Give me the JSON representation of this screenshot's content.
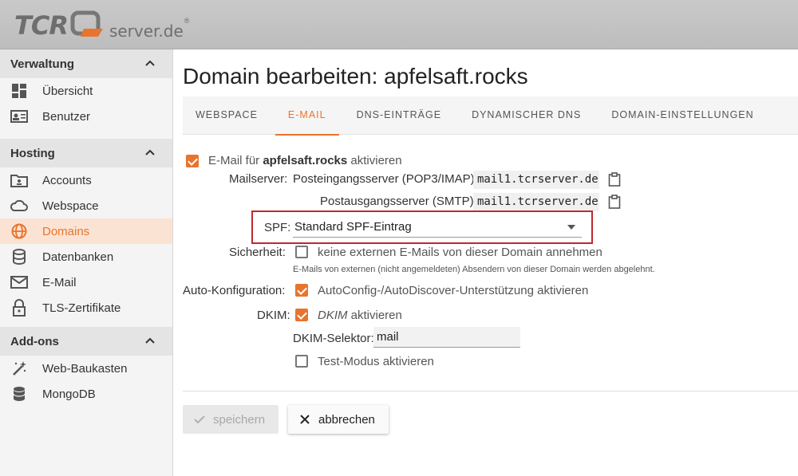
{
  "logo": {
    "brand": "TCR",
    "domain": "server.de",
    "reg": "®"
  },
  "sidebar": {
    "sections": [
      {
        "title": "Verwaltung",
        "items": [
          {
            "label": "Übersicht",
            "icon": "dashboard-icon"
          },
          {
            "label": "Benutzer",
            "icon": "id-card-icon"
          }
        ]
      },
      {
        "title": "Hosting",
        "items": [
          {
            "label": "Accounts",
            "icon": "account-folder-icon"
          },
          {
            "label": "Webspace",
            "icon": "cloud-icon"
          },
          {
            "label": "Domains",
            "icon": "globe-icon",
            "active": true
          },
          {
            "label": "Datenbanken",
            "icon": "database-icon"
          },
          {
            "label": "E-Mail",
            "icon": "envelope-icon"
          },
          {
            "label": "TLS-Zertifikate",
            "icon": "lock-icon"
          }
        ]
      },
      {
        "title": "Add-ons",
        "items": [
          {
            "label": "Web-Baukasten",
            "icon": "magic-wand-icon"
          },
          {
            "label": "MongoDB",
            "icon": "database-icon"
          }
        ]
      }
    ]
  },
  "page": {
    "title": "Domain bearbeiten: apfelsaft.rocks"
  },
  "tabs": [
    "WEBSPACE",
    "E-MAIL",
    "DNS-EINTRÄGE",
    "DYNAMISCHER DNS",
    "DOMAIN-EINSTELLUNGEN"
  ],
  "active_tab": "E-MAIL",
  "form": {
    "enable_prefix": "E-Mail für ",
    "enable_domain": "apfelsaft.rocks",
    "enable_suffix": " aktivieren",
    "enable_checked": true,
    "mailserver_label": "Mailserver:",
    "incoming_label": "Posteingangsserver (POP3/IMAP):",
    "incoming_value": "mail1.tcrserver.de",
    "outgoing_label": "Postausgangsserver (SMTP):",
    "outgoing_value": "mail1.tcrserver.de",
    "spf_label": "SPF:",
    "spf_value": "Standard SPF-Eintrag",
    "security_label": "Sicherheit:",
    "security_option": "keine externen E-Mails von dieser Domain annehmen",
    "security_checked": false,
    "security_hint": "E-Mails von externen (nicht angemeldeten) Absendern von dieser Domain werden abgelehnt.",
    "autoconfig_label": "Auto-Konfiguration:",
    "autoconfig_option": "AutoConfig-/AutoDiscover-Unterstützung aktivieren",
    "autoconfig_checked": true,
    "dkim_label": "DKIM:",
    "dkim_option_em": "DKIM",
    "dkim_option_rest": " aktivieren",
    "dkim_checked": true,
    "dkim_selector_label": "DKIM-Selektor:",
    "dkim_selector_value": "mail",
    "testmode_option": "Test-Modus aktivieren",
    "testmode_checked": false
  },
  "buttons": {
    "save": "speichern",
    "cancel": "abbrechen"
  },
  "colors": {
    "accent": "#e8742d",
    "highlight": "#c0282d",
    "active_bg": "#fbe3d4"
  }
}
